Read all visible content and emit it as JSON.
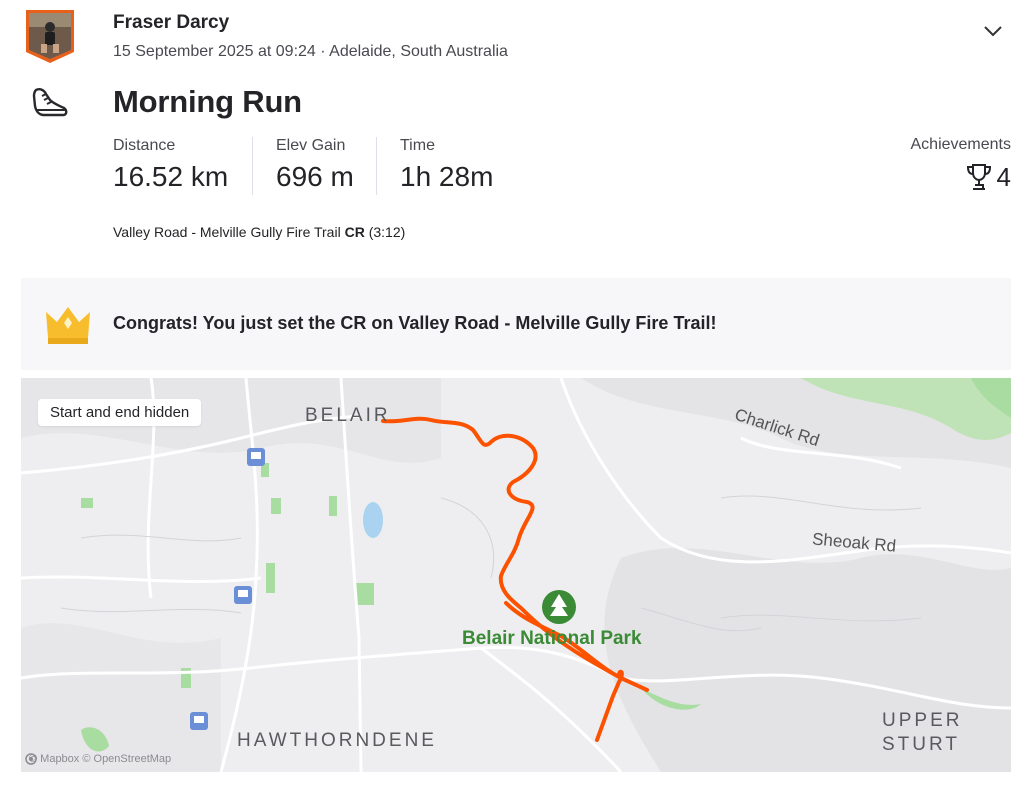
{
  "athlete": {
    "name": "Fraser Darcy",
    "meta": "15 September 2025 at 09:24 · Adelaide, South Australia"
  },
  "activity": {
    "icon": "running-shoe-icon",
    "title": "Morning Run"
  },
  "stats": [
    {
      "label": "Distance",
      "value": "16.52 km"
    },
    {
      "label": "Elev Gain",
      "value": "696 m"
    },
    {
      "label": "Time",
      "value": "1h 28m"
    }
  ],
  "achievements": {
    "label": "Achievements",
    "count": "4",
    "icon": "trophy-icon"
  },
  "segment": {
    "name": "Valley Road - Melville Gully Fire Trail",
    "badge": "CR",
    "time": "(3:12)"
  },
  "banner": {
    "icon": "crown-icon",
    "text": "Congrats! You just set the CR on Valley Road - Melville Gully Fire Trail!"
  },
  "map": {
    "badge": "Start and end hidden",
    "places": {
      "belair": "BELAIR",
      "hawthorndene": "HAWTHORNDENE",
      "upper": "UPPER",
      "sturt": "STURT"
    },
    "roads": {
      "charlick": "Charlick Rd",
      "sheoak": "Sheoak Rd"
    },
    "park": "Belair National Park",
    "attribution": "© Mapbox © OpenStreetMap",
    "colors": {
      "route": "#fc5200",
      "park": "#3a8a36",
      "greenery": "#a9dca0"
    }
  },
  "colors": {
    "accent": "#fc5200",
    "banner_bg": "#f7f7fa",
    "crown": "#f7bd2d"
  }
}
